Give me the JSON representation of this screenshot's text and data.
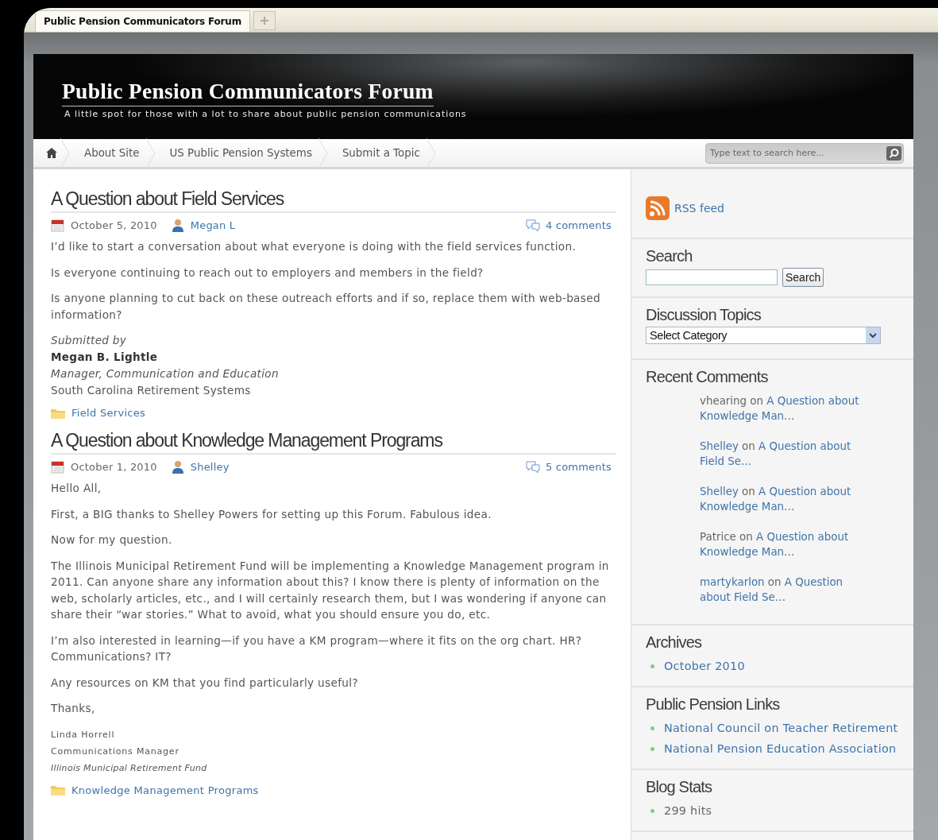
{
  "browser": {
    "tabs": [
      {
        "label": "Public Pension Communicators Forum",
        "selected": true
      }
    ]
  },
  "site": {
    "title": "Public Pension Communicators Forum",
    "tagline": "A little spot for those with a lot to share about public pension communications"
  },
  "nav": {
    "items": [
      "About Site",
      "US Public Pension Systems",
      "Submit a Topic"
    ],
    "search": {
      "placeholder": "Type text to search here..."
    }
  },
  "posts": [
    {
      "title": "A Question about Field Services",
      "date": "October 5, 2010",
      "author": "Megan L",
      "comments": "4 comments",
      "body": [
        "I’d like to start a conversation about what everyone is doing with the field services function.",
        "Is everyone continuing to reach out to employers and members in the field?",
        "Is anyone planning to cut back on these outreach efforts and if so, replace them with web-based information?"
      ],
      "signature": {
        "kind": "full",
        "lines": [
          "Submitted by",
          "Megan B. Lightle",
          "Manager, Communication and Education",
          "South Carolina Retirement Systems"
        ]
      },
      "category": "Field Services"
    },
    {
      "title": "A Question about Knowledge Management Programs",
      "date": "October 1, 2010",
      "author": "Shelley",
      "comments": "5 comments",
      "body": [
        "Hello All,",
        "First, a BIG thanks to Shelley Powers for setting up this Forum. Fabulous idea.",
        "Now for my question.",
        "The Illinois Municipal Retirement Fund will be implementing a Knowledge Management program in 2011. Can anyone share any information about this? I know there is plenty of information on the web, scholarly articles, etc., and I will certainly research them, but I was wondering if anyone can share their “war stories.” What to avoid, what you should ensure you do, etc.",
        "I’m also interested in learning—if you have a KM program—where it fits on the org chart. HR? Communications? IT?",
        "Any resources on KM that you find particularly useful?",
        "Thanks,"
      ],
      "signature": {
        "kind": "compact",
        "lines": [
          "Linda Horrell",
          "Communications Manager",
          "Illinois Municipal Retirement Fund"
        ]
      },
      "category": "Knowledge Management Programs"
    }
  ],
  "sidebar": [
    {
      "kind": "rss",
      "link": "RSS feed"
    },
    {
      "kind": "search",
      "title": "Search",
      "button": "Search"
    },
    {
      "kind": "select",
      "title": "Discussion Topics",
      "value": "Select Category"
    },
    {
      "kind": "comments",
      "title": "Recent Comments",
      "items": [
        {
          "author": "vhearing",
          "author_link": false,
          "word": "on",
          "post": "A Question about Knowledge Man…"
        },
        {
          "author": "Shelley",
          "author_link": true,
          "word": "on",
          "post": "A Question about Field Se…"
        },
        {
          "author": "Shelley",
          "author_link": true,
          "word": "on",
          "post": "A Question about Knowledge Man…"
        },
        {
          "author": "Patrice",
          "author_link": false,
          "word": "on",
          "post": "A Question about Knowledge Man…"
        },
        {
          "author": "martykarlon",
          "author_link": true,
          "word": "on",
          "post": "A Question about Field Se…"
        }
      ]
    },
    {
      "kind": "list",
      "title": "Archives",
      "items": [
        {
          "text": "October 2010",
          "link": true
        }
      ]
    },
    {
      "kind": "list",
      "title": "Public Pension Links",
      "items": [
        {
          "text": "National Council on Teacher Retirement",
          "link": true
        },
        {
          "text": "National Pension Education Association",
          "link": true
        }
      ]
    },
    {
      "kind": "list",
      "title": "Blog Stats",
      "items": [
        {
          "text": "299 hits",
          "link": false
        }
      ]
    }
  ]
}
